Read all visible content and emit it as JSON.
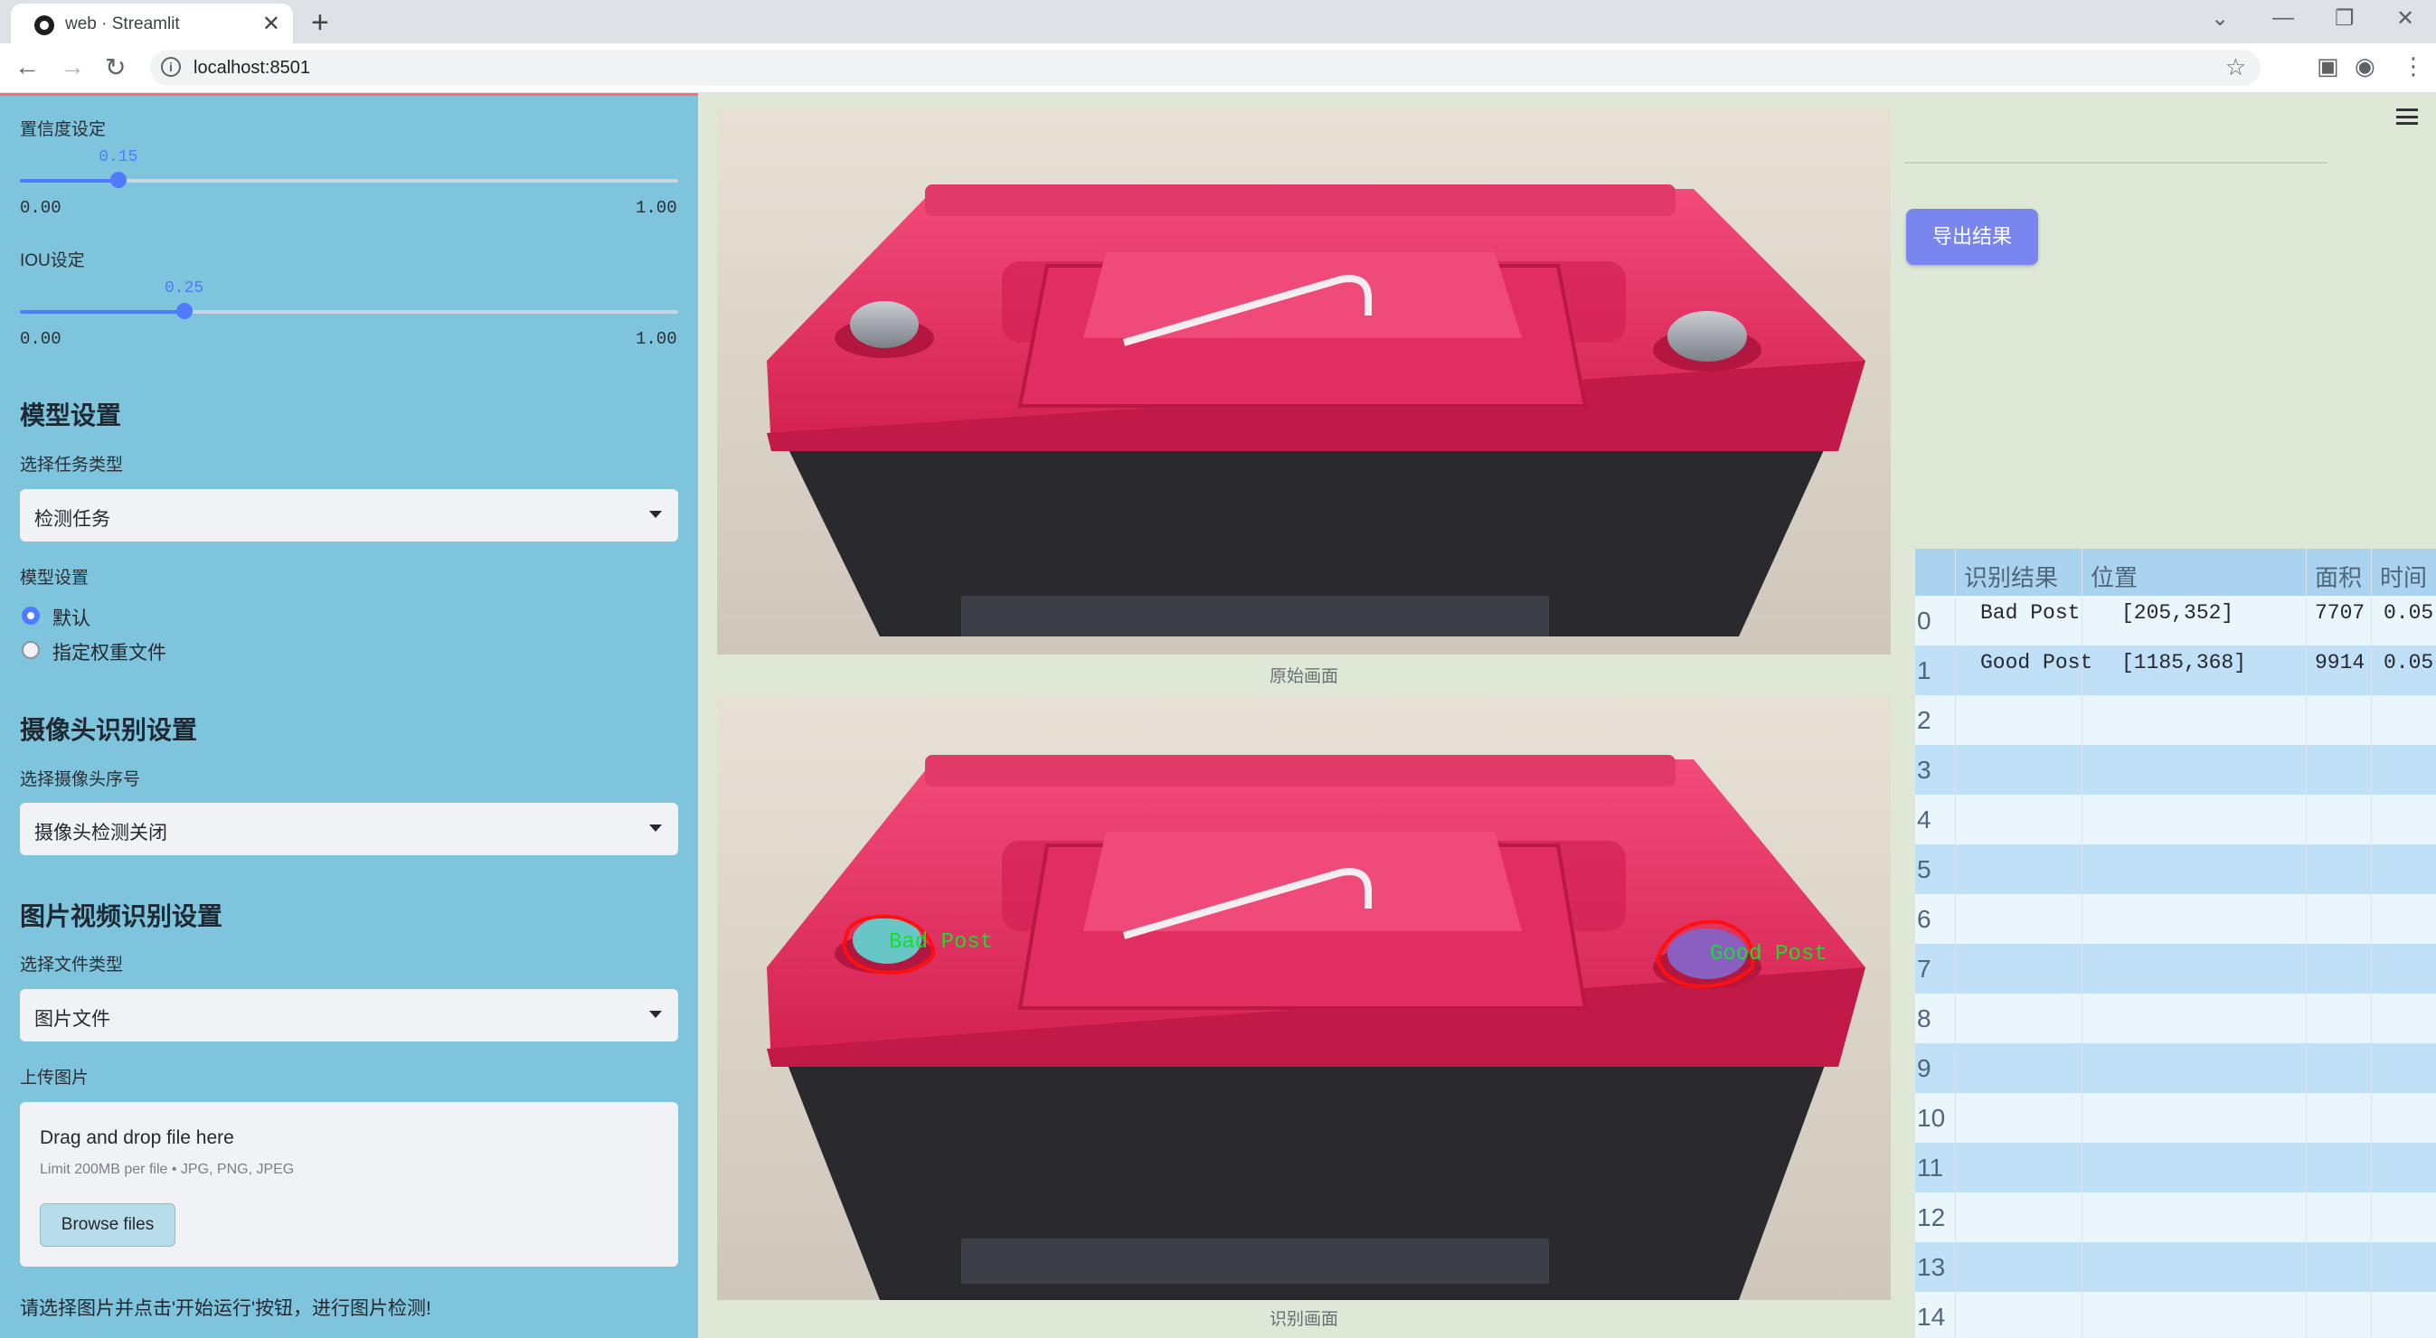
{
  "browser": {
    "tab_title": "web · Streamlit",
    "url": "localhost:8501"
  },
  "sidebar": {
    "conf_label": "置信度设定",
    "conf_value": "0.15",
    "conf_min": "0.00",
    "conf_max": "1.00",
    "conf_fraction": 0.15,
    "iou_label": "IOU设定",
    "iou_value": "0.25",
    "iou_min": "0.00",
    "iou_max": "1.00",
    "iou_fraction": 0.25,
    "model_heading": "模型设置",
    "task_label": "选择任务类型",
    "task_value": "检测任务",
    "model_label": "模型设置",
    "radio_default": "默认",
    "radio_custom": "指定权重文件",
    "camera_heading": "摄像头识别设置",
    "camera_label": "选择摄像头序号",
    "camera_value": "摄像头检测关闭",
    "media_heading": "图片视频识别设置",
    "filetype_label": "选择文件类型",
    "filetype_value": "图片文件",
    "upload_label": "上传图片",
    "drop_text": "Drag and drop file here",
    "limit_text": "Limit 200MB per file • JPG, PNG, JPEG",
    "browse_label": "Browse files",
    "footer_text": "请选择图片并点击'开始运行'按钮，进行图片检测!"
  },
  "main": {
    "caption_original": "原始画面",
    "caption_detected": "识别画面",
    "detections": [
      "Bad Post",
      "Good Post"
    ]
  },
  "right": {
    "export_label": "导出结果",
    "table": {
      "headers": [
        "识别结果",
        "位置",
        "面积",
        "时间"
      ],
      "rows": [
        {
          "idx": "0",
          "result": "Bad Post",
          "pos": "[205,352]",
          "area": "7707",
          "time": "0.05"
        },
        {
          "idx": "1",
          "result": "Good Post",
          "pos": "[1185,368]",
          "area": "9914",
          "time": "0.05"
        },
        {
          "idx": "2"
        },
        {
          "idx": "3"
        },
        {
          "idx": "4"
        },
        {
          "idx": "5"
        },
        {
          "idx": "6"
        },
        {
          "idx": "7"
        },
        {
          "idx": "8"
        },
        {
          "idx": "9"
        },
        {
          "idx": "10"
        },
        {
          "idx": "11"
        },
        {
          "idx": "12"
        },
        {
          "idx": "13"
        },
        {
          "idx": "14"
        }
      ]
    }
  }
}
